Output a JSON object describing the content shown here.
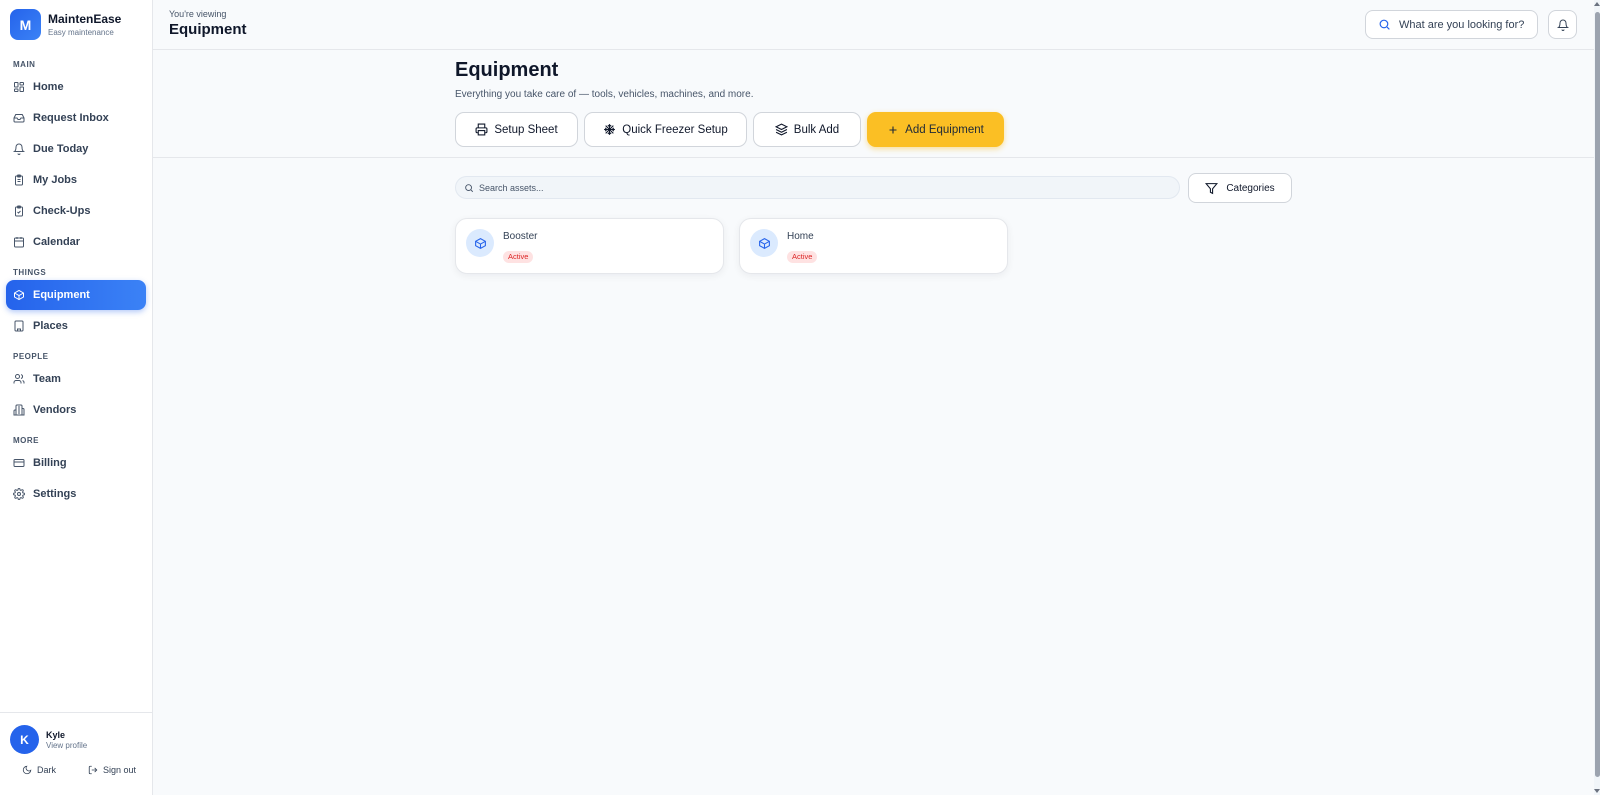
{
  "brand": {
    "initial": "M",
    "name": "MaintenEase",
    "tagline": "Easy maintenance"
  },
  "sidebar": {
    "sections": [
      {
        "label": "MAIN",
        "items": [
          "Home",
          "Request Inbox",
          "Due Today",
          "My Jobs",
          "Check-Ups",
          "Calendar"
        ]
      },
      {
        "label": "THINGS",
        "items": [
          "Equipment",
          "Places"
        ]
      },
      {
        "label": "PEOPLE",
        "items": [
          "Team",
          "Vendors"
        ]
      },
      {
        "label": "MORE",
        "items": [
          "Billing",
          "Settings"
        ]
      }
    ],
    "active": "Equipment"
  },
  "user": {
    "initial": "K",
    "name": "Kyle",
    "link": "View profile"
  },
  "footer": {
    "theme_label": "Dark",
    "signout_label": "Sign out"
  },
  "topbar": {
    "viewing_label": "You're viewing",
    "viewing_title": "Equipment",
    "search_placeholder": "What are you looking for?"
  },
  "page": {
    "title": "Equipment",
    "subtitle": "Everything you take care of — tools, vehicles, machines, and more.",
    "actions": {
      "setup_sheet": "Setup Sheet",
      "quick_freezer": "Quick Freezer Setup",
      "bulk_add": "Bulk Add",
      "add_equipment": "Add Equipment"
    }
  },
  "filters": {
    "search_placeholder": "Search assets...",
    "categories_label": "Categories"
  },
  "assets": [
    {
      "name": "Booster",
      "status": "Active"
    },
    {
      "name": "Home",
      "status": "Active"
    }
  ],
  "colors": {
    "accent": "#2563eb",
    "primary_action": "#fbbf24",
    "status_badge_bg": "#fee2e2",
    "status_badge_text": "#dc2626"
  }
}
